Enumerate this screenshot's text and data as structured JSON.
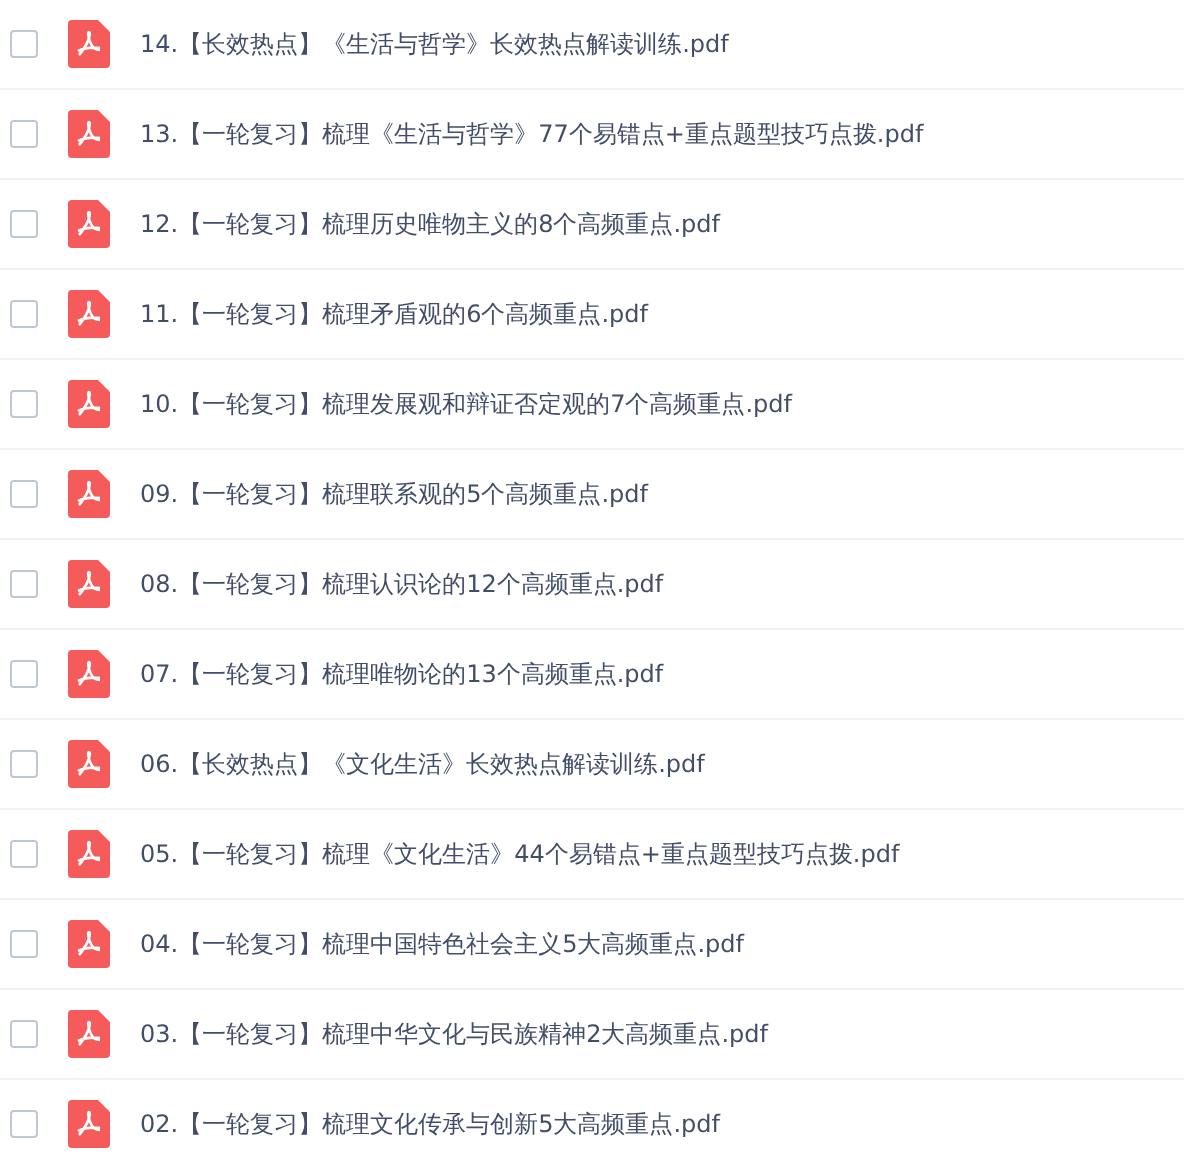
{
  "files": [
    {
      "name": "14.【长效热点】《生活与哲学》长效热点解读训练.pdf",
      "checked": false
    },
    {
      "name": "13.【一轮复习】梳理《生活与哲学》77个易错点+重点题型技巧点拨.pdf",
      "checked": false
    },
    {
      "name": "12.【一轮复习】梳理历史唯物主义的8个高频重点.pdf",
      "checked": false
    },
    {
      "name": "11.【一轮复习】梳理矛盾观的6个高频重点.pdf",
      "checked": false
    },
    {
      "name": "10.【一轮复习】梳理发展观和辩证否定观的7个高频重点.pdf",
      "checked": false
    },
    {
      "name": "09.【一轮复习】梳理联系观的5个高频重点.pdf",
      "checked": false
    },
    {
      "name": "08.【一轮复习】梳理认识论的12个高频重点.pdf",
      "checked": false
    },
    {
      "name": "07.【一轮复习】梳理唯物论的13个高频重点.pdf",
      "checked": false
    },
    {
      "name": "06.【长效热点】《文化生活》长效热点解读训练.pdf",
      "checked": false
    },
    {
      "name": "05.【一轮复习】梳理《文化生活》44个易错点+重点题型技巧点拨.pdf",
      "checked": false
    },
    {
      "name": "04.【一轮复习】梳理中国特色社会主义5大高频重点.pdf",
      "checked": false
    },
    {
      "name": "03.【一轮复习】梳理中华文化与民族精神2大高频重点.pdf",
      "checked": false
    },
    {
      "name": "02.【一轮复习】梳理文化传承与创新5大高频重点.pdf",
      "checked": false
    }
  ]
}
